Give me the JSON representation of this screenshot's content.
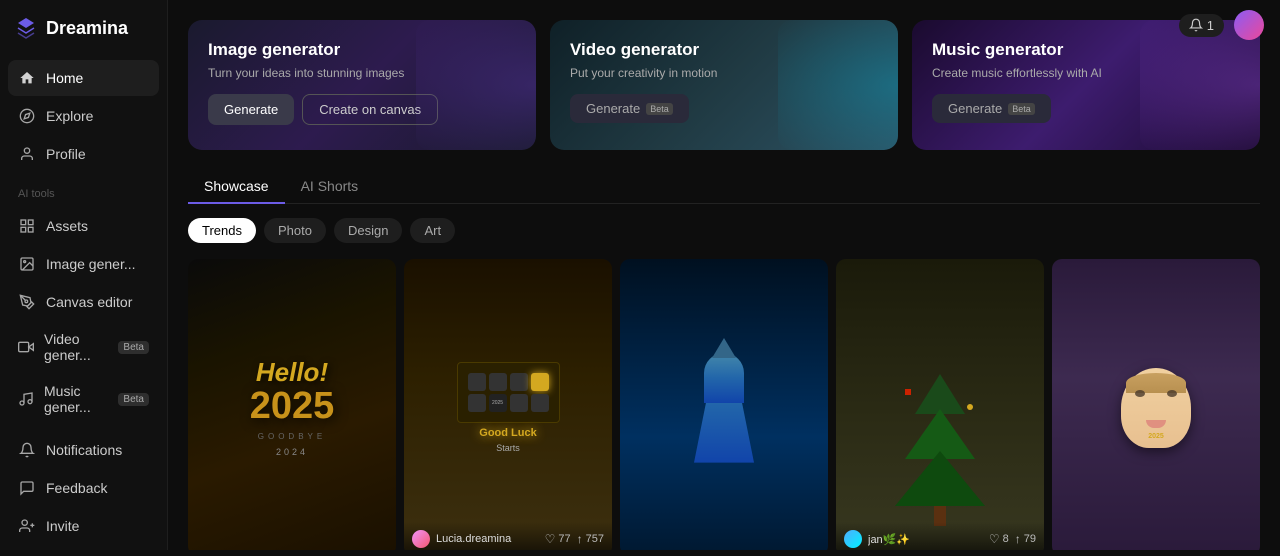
{
  "app": {
    "name": "Dreamina",
    "logo_text": "Dreamina"
  },
  "sidebar": {
    "nav_items": [
      {
        "id": "home",
        "label": "Home",
        "icon": "home"
      },
      {
        "id": "explore",
        "label": "Explore",
        "icon": "compass"
      },
      {
        "id": "profile",
        "label": "Profile",
        "icon": "user"
      }
    ],
    "ai_tools_label": "AI tools",
    "ai_tool_items": [
      {
        "id": "assets",
        "label": "Assets",
        "icon": "grid"
      },
      {
        "id": "image-generator",
        "label": "Image gener...",
        "icon": "image"
      },
      {
        "id": "canvas-editor",
        "label": "Canvas editor",
        "icon": "pen-tool"
      },
      {
        "id": "video-generator",
        "label": "Video gener...",
        "icon": "video",
        "badge": "Beta"
      },
      {
        "id": "music-generator",
        "label": "Music gener...",
        "icon": "music",
        "badge": "Beta"
      }
    ],
    "bottom_items": [
      {
        "id": "notifications",
        "label": "Notifications",
        "icon": "bell"
      },
      {
        "id": "feedback",
        "label": "Feedback",
        "icon": "message"
      },
      {
        "id": "invite",
        "label": "Invite",
        "icon": "user-plus"
      }
    ]
  },
  "header": {
    "notification_count": "1",
    "notification_label": "1"
  },
  "generator_cards": [
    {
      "id": "image",
      "title": "Image generator",
      "description": "Turn your ideas into stunning images",
      "btn1": "Generate",
      "btn2": "Create on canvas"
    },
    {
      "id": "video",
      "title": "Video generator",
      "description": "Put your creativity in motion",
      "btn1": "Generate",
      "btn1_badge": "Beta"
    },
    {
      "id": "music",
      "title": "Music generator",
      "description": "Create music effortlessly with AI",
      "btn1": "Generate",
      "btn1_badge": "Beta"
    }
  ],
  "tabs": [
    {
      "id": "showcase",
      "label": "Showcase",
      "active": true
    },
    {
      "id": "ai-shorts",
      "label": "AI Shorts",
      "active": false
    }
  ],
  "filters": [
    {
      "id": "trends",
      "label": "Trends",
      "active": true
    },
    {
      "id": "photo",
      "label": "Photo",
      "active": false
    },
    {
      "id": "design",
      "label": "Design",
      "active": false
    },
    {
      "id": "art",
      "label": "Art",
      "active": false
    }
  ],
  "showcase_images": [
    {
      "id": "hello2025",
      "type": "hello2025",
      "user": null,
      "likes": null,
      "views": null
    },
    {
      "id": "keyboard",
      "type": "keyboard",
      "user": "Lucia.dreamina",
      "likes": "77",
      "views": "757"
    },
    {
      "id": "shark",
      "type": "shark",
      "user": null,
      "likes": null,
      "views": null
    },
    {
      "id": "christmas",
      "type": "christmas",
      "user": "jan🌿✨",
      "likes": "8",
      "views": "79"
    },
    {
      "id": "baby",
      "type": "baby",
      "user": null,
      "likes": null,
      "views": null
    }
  ]
}
